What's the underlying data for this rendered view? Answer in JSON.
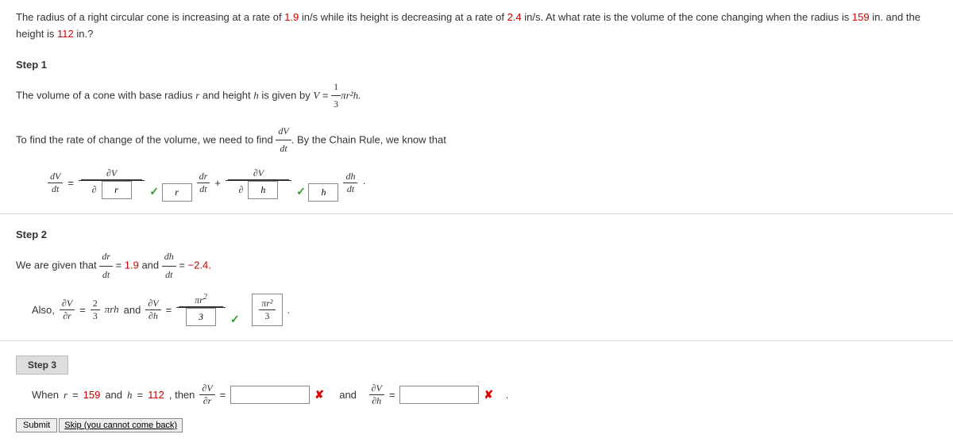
{
  "problem": {
    "prefix": "The radius of a right circular cone is increasing at a rate of ",
    "rate1": "1.9",
    "mid1": " in/s while its height is decreasing at a rate of ",
    "rate2": "2.4",
    "mid2": " in/s. At what rate is the volume of the cone changing when the radius is ",
    "radius": "159",
    "mid3": " in. and the height is ",
    "height": "112",
    "suffix": " in.?"
  },
  "step1": {
    "label": "Step 1",
    "line1_a": "The volume of a cone with base radius ",
    "line1_b": " and height ",
    "line1_c": " is given by ",
    "line2_a": "To find the rate of change of the volume, we need to find ",
    "line2_b": ". By the Chain Rule, we know that",
    "r": "r",
    "h": "h",
    "V": "V",
    "eq": " = ",
    "frac13": "1",
    "denom3": "3",
    "pi_r2_h": "πr²h.",
    "dV": "dV",
    "dt": "dt",
    "dr": "dr",
    "dh": "dh",
    "partialV": "∂V",
    "partial": "∂",
    "plus": " + ",
    "dot": "·",
    "input_r": "r",
    "input_h": "h"
  },
  "step2": {
    "label": "Step 2",
    "given_a": "We are given that ",
    "given_b": " = ",
    "val1": "1.9",
    "and": " and ",
    "val2": "−2.4.",
    "also": "Also, ",
    "twothirds_n": "2",
    "twothirds_d": "3",
    "pi_rh": "πrh",
    "partialr": "∂r",
    "partialh": "∂h",
    "pi_r2_num": "πr",
    "pi_r2_sup": "2",
    "three": "3",
    "boxed_num": "πr²",
    "boxed_den": "3"
  },
  "step3": {
    "label": "Step 3",
    "when_a": "When ",
    "when_b": " = ",
    "r_val": "159",
    "and": " and ",
    "h_val": "112",
    "then": ", then ",
    "and2": "and",
    "eq": " = ",
    "dot": "."
  },
  "buttons": {
    "submit": "Submit",
    "skip": "Skip (you cannot come back)"
  }
}
